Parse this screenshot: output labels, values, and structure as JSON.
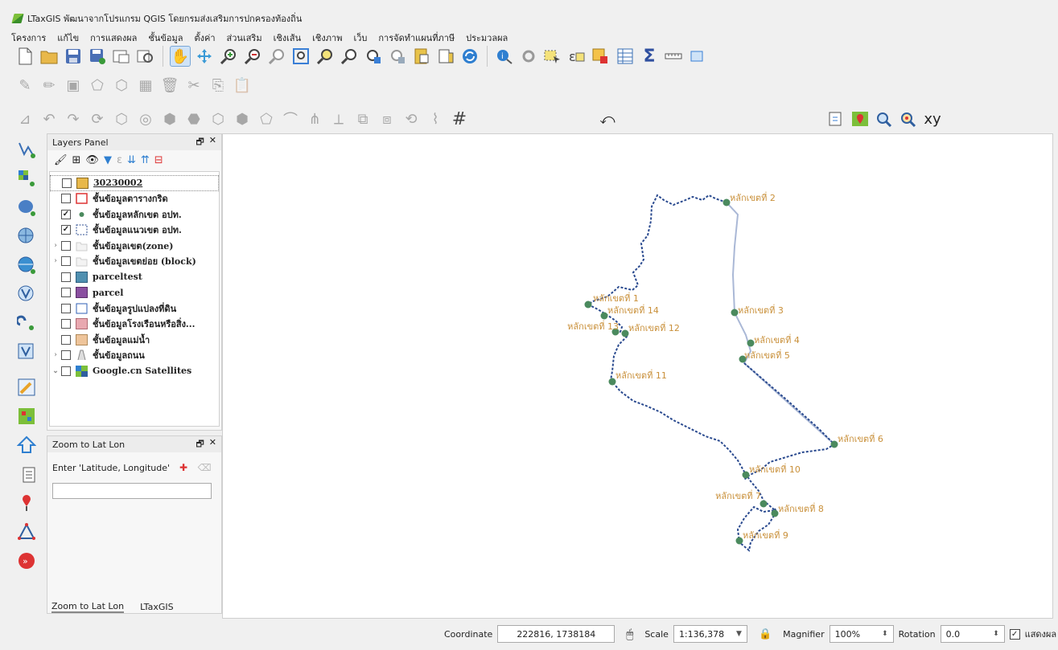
{
  "window": {
    "title": "LTaxGIS พัฒนาจากโปรแกรม QGIS โดยกรมส่งเสริมการปกครองท้องถิ่น"
  },
  "menu": [
    "โครงการ",
    "แก้ไข",
    "การแสดงผล",
    "ชั้นข้อมูล",
    "ตั้งค่า",
    "ส่วนเสริม",
    "เชิงเส้น",
    "เชิงภาพ",
    "เว็บ",
    "การจัดทำแผนที่ภาษี",
    "ประมวลผล"
  ],
  "layers_panel": {
    "title": "Layers Panel",
    "layers": [
      {
        "name": "30230002",
        "checked": false,
        "symbol": "fill-orange",
        "underline": true
      },
      {
        "name": "ชั้นข้อมูลตารางกริด",
        "checked": false,
        "symbol": "outline-red"
      },
      {
        "name": "ชั้นข้อมูลหลักเขต อปท.",
        "checked": true,
        "symbol": "point-green"
      },
      {
        "name": "ชั้นข้อมูลแนวเขต อปท.",
        "checked": true,
        "symbol": "outline-dashed"
      },
      {
        "name": "ชั้นข้อมูลเขต(zone)",
        "checked": false,
        "symbol": "group",
        "expandable": true
      },
      {
        "name": "ชั้นข้อมูลเขตย่อย (block)",
        "checked": false,
        "symbol": "group",
        "expandable": true
      },
      {
        "name": "parceltest",
        "checked": false,
        "symbol": "fill-teal"
      },
      {
        "name": "parcel",
        "checked": false,
        "symbol": "fill-purple"
      },
      {
        "name": "ชั้นข้อมูลรูปแปลงที่ดิน",
        "checked": false,
        "symbol": "outline-blue"
      },
      {
        "name": "ชั้นข้อมูลโรงเรือนหรือสิ่ง...",
        "checked": false,
        "symbol": "fill-pink"
      },
      {
        "name": "ชั้นข้อมูลแม่น้ำ",
        "checked": false,
        "symbol": "fill-peach"
      },
      {
        "name": "ชั้นข้อมูลถนน",
        "checked": false,
        "symbol": "group-road",
        "expandable": true
      },
      {
        "name": "Google.cn Satellites",
        "checked": false,
        "symbol": "raster",
        "expandable": true,
        "expanded": true
      }
    ]
  },
  "zoom_panel": {
    "title": "Zoom to Lat Lon",
    "prompt": "Enter 'Latitude, Longitude'",
    "input_value": ""
  },
  "bottom_tabs": [
    "Zoom to Lat Lon",
    "LTaxGIS"
  ],
  "map": {
    "boundary_color": "#2a4a8f",
    "marker_color": "#4b8a5e",
    "label_color": "#c9903a",
    "markers": [
      {
        "label": "หลักเขตที่ 1"
      },
      {
        "label": "หลักเขตที่ 2"
      },
      {
        "label": "หลักเขตที่ 3"
      },
      {
        "label": "หลักเขตที่ 4"
      },
      {
        "label": "หลักเขตที่ 5"
      },
      {
        "label": "หลักเขตที่ 6"
      },
      {
        "label": "หลักเขตที่ 7"
      },
      {
        "label": "หลักเขตที่ 8"
      },
      {
        "label": "หลักเขตที่ 9"
      },
      {
        "label": "หลักเขตที่ 10"
      },
      {
        "label": "หลักเขตที่ 11"
      },
      {
        "label": "หลักเขตที่ 12"
      },
      {
        "label": "หลักเขตที่ 13"
      },
      {
        "label": "หลักเขตที่ 14"
      }
    ]
  },
  "status": {
    "coordinate_label": "Coordinate",
    "coordinate_value": "222816, 1738184",
    "scale_label": "Scale",
    "scale_value": "1:136,378",
    "magnifier_label": "Magnifier",
    "magnifier_value": "100%",
    "rotation_label": "Rotation",
    "rotation_value": "0.0",
    "render_label": "แสดงผล",
    "render_checked": true
  }
}
